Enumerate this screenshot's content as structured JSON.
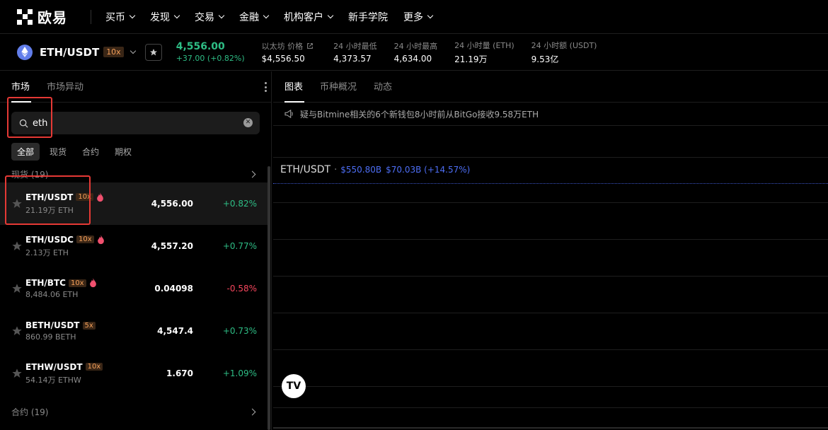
{
  "nav": {
    "logo_text": "欧易",
    "items": [
      {
        "label": "买币",
        "has_menu": true
      },
      {
        "label": "发现",
        "has_menu": true
      },
      {
        "label": "交易",
        "has_menu": true
      },
      {
        "label": "金融",
        "has_menu": true
      },
      {
        "label": "机构客户",
        "has_menu": true
      },
      {
        "label": "新手学院",
        "has_menu": false
      },
      {
        "label": "更多",
        "has_menu": true
      }
    ]
  },
  "ticker": {
    "pair": "ETH/USDT",
    "leverage": "10x",
    "price": "4,556.00",
    "change": "+37.00 (+0.82%)",
    "stats": [
      {
        "label": "以太坊 价格",
        "value": "$4,556.50",
        "link_icon": "external-link-icon"
      },
      {
        "label": "24 小时最低",
        "value": "4,373.57"
      },
      {
        "label": "24 小时最高",
        "value": "4,634.00"
      },
      {
        "label": "24 小时量 (ETH)",
        "value": "21.19万"
      },
      {
        "label": "24 小时额 (USDT)",
        "value": "9.53亿"
      }
    ]
  },
  "market": {
    "tabs": [
      "市场",
      "市场异动"
    ],
    "search": {
      "value": "eth",
      "placeholder": ""
    },
    "filters": [
      "全部",
      "现货",
      "合约",
      "期权"
    ],
    "spot_group": "现货 (19)",
    "futures_group": "合约 (19)",
    "rows": [
      {
        "pair": "ETH/USDT",
        "lev": "10x",
        "hot": true,
        "vol": "21.19万 ETH",
        "price": "4,556.00",
        "change": "+0.82%",
        "dir": "up"
      },
      {
        "pair": "ETH/USDC",
        "lev": "10x",
        "hot": true,
        "vol": "2.13万 ETH",
        "price": "4,557.20",
        "change": "+0.77%",
        "dir": "up"
      },
      {
        "pair": "ETH/BTC",
        "lev": "10x",
        "hot": true,
        "vol": "8,484.06 ETH",
        "price": "0.04098",
        "change": "-0.58%",
        "dir": "down"
      },
      {
        "pair": "BETH/USDT",
        "lev": "5x",
        "hot": false,
        "vol": "860.99 BETH",
        "price": "4,547.4",
        "change": "+0.73%",
        "dir": "up"
      },
      {
        "pair": "ETHW/USDT",
        "lev": "10x",
        "hot": false,
        "vol": "54.14万 ETHW",
        "price": "1.670",
        "change": "+1.09%",
        "dir": "up"
      }
    ]
  },
  "chart_panel": {
    "tabs": [
      "图表",
      "币种概况",
      "动态"
    ],
    "news": "疑与Bitmine相关的6个新钱包8小时前从BitGo接收9.58万ETH",
    "title": "ETH/USDT",
    "value1": "$550.80B",
    "value2": "$70.03B (+14.57%)",
    "tv_logo": "TV"
  },
  "colors": {
    "up": "#2ebd85",
    "down": "#f6465d",
    "accent_blue": "#4d6ef5",
    "leverage": "#f5a05a",
    "eth_brand": "#627eea",
    "annotation": "#e53935"
  }
}
